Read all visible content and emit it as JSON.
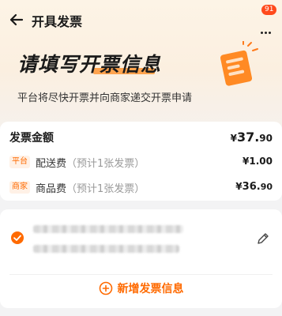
{
  "header": {
    "title": "开具发票",
    "badge_count": "91"
  },
  "hero": {
    "headline": "请填写开票信息",
    "subtitle": "平台将尽快开票并向商家递交开票申请"
  },
  "amount": {
    "label": "发票金额",
    "currency": "¥",
    "total_int": "37.",
    "total_dec": "90",
    "rows": [
      {
        "tag": "平台",
        "label": "配送费",
        "note": "（预计1张发票）",
        "currency": "¥",
        "value": "1.00"
      },
      {
        "tag": "商家",
        "label": "商品费",
        "note": "（预计1张发票）",
        "currency": "¥",
        "value_int": "36.",
        "value_dec": "90"
      }
    ]
  },
  "invoice_info": {
    "add_label": "新增发票信息"
  },
  "colors": {
    "accent": "#ff6a00",
    "badge": "#ff4a1c"
  }
}
